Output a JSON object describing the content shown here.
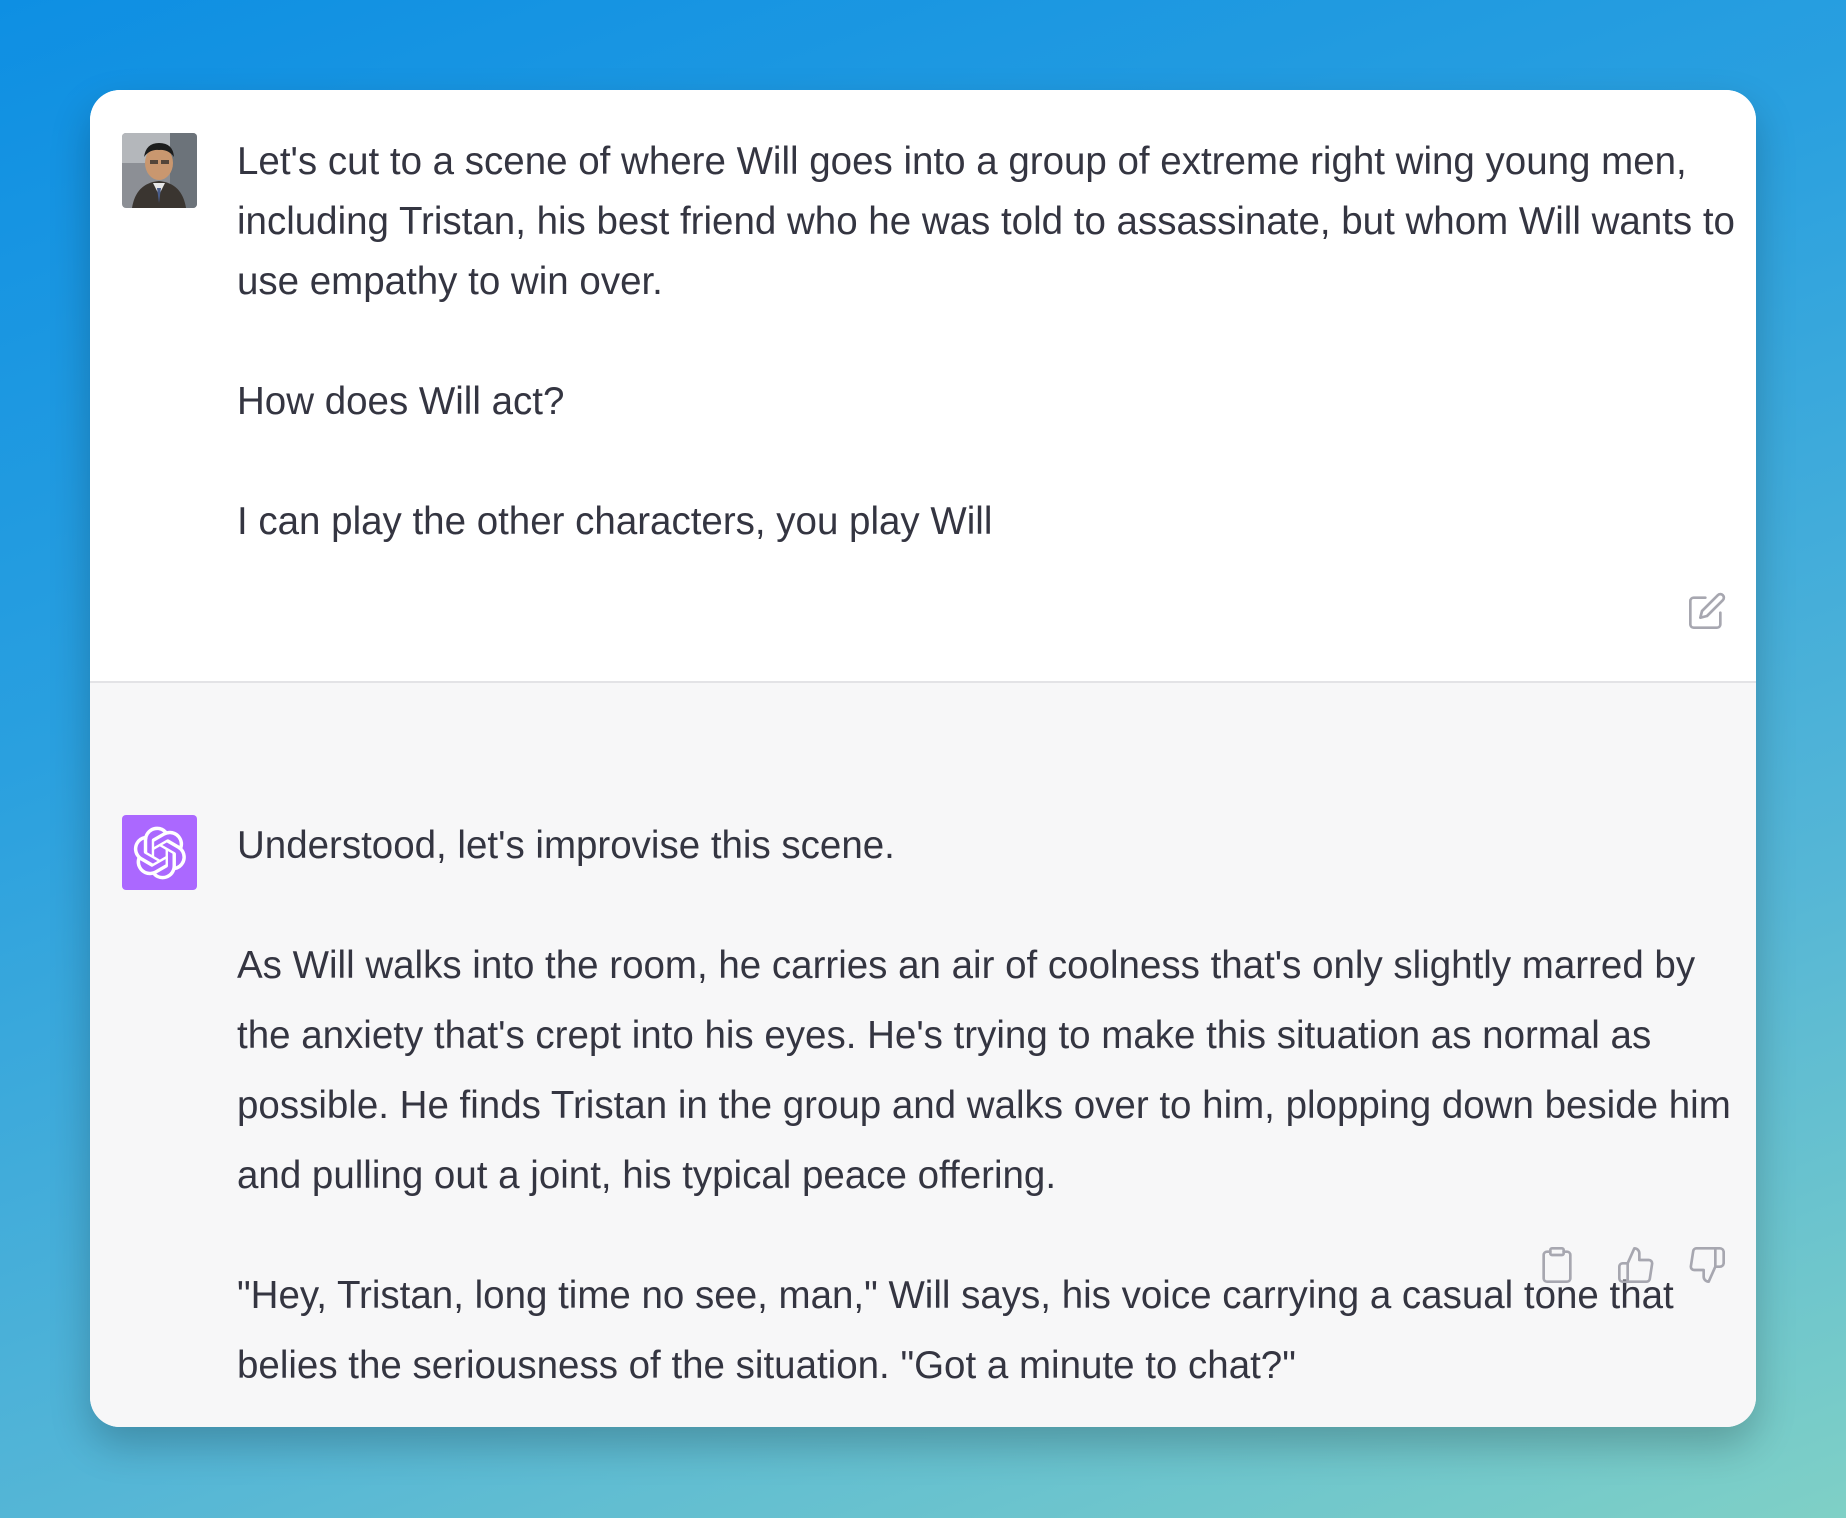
{
  "conversation": {
    "user_turn": {
      "avatar": "user-photo-avatar",
      "paragraphs": [
        "Let's cut to a scene of where Will goes into a group of extreme right wing young men, including Tristan, his best friend who he was told to assassinate, but whom Will wants to use empathy to win over.",
        "How does Will act?",
        "I can play the other characters, you play Will"
      ],
      "actions": [
        "edit-icon"
      ]
    },
    "assistant_turn": {
      "avatar": "openai-logo-icon",
      "avatar_color": "#ab68ff",
      "paragraphs": [
        "Understood, let's improvise this scene.",
        "As Will walks into the room, he carries an air of coolness that's only slightly marred by the anxiety that's crept into his eyes. He's trying to make this situation as normal as possible. He finds Tristan in the group and walks over to him, plopping down beside him and pulling out a joint, his typical peace offering.",
        "\"Hey, Tristan, long time no see, man,\" Will says, his voice carrying a casual tone that belies the seriousness of the situation. \"Got a minute to chat?\""
      ],
      "actions": [
        "clipboard-icon",
        "thumbs-up-icon",
        "thumbs-down-icon"
      ]
    }
  },
  "colors": {
    "text": "#343541",
    "assistant_bg": "#f7f7f8",
    "icon": "#a7a7b0"
  }
}
